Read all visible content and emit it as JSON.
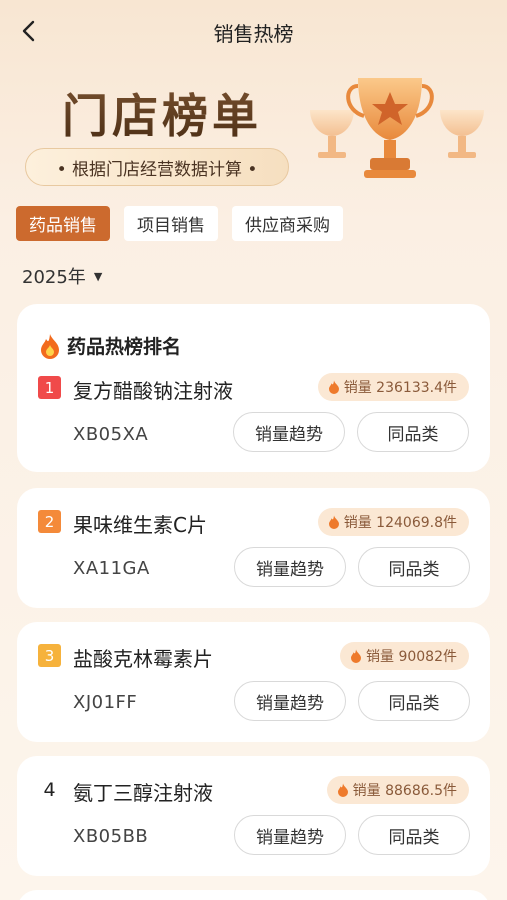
{
  "nav": {
    "title": "销售热榜"
  },
  "hero": {
    "title": "门店榜单",
    "subtitle": "• 根据门店经营数据计算 •"
  },
  "tabs": [
    {
      "label": "药品销售",
      "active": true
    },
    {
      "label": "项目销售",
      "active": false
    },
    {
      "label": "供应商采购",
      "active": false
    }
  ],
  "year": {
    "label": "2025年"
  },
  "list": {
    "header": "药品热榜排名",
    "trend_label": "销量趋势",
    "same_label": "同品类",
    "items": [
      {
        "rank": "1",
        "name": "复方醋酸钠注射液",
        "code": "XB05XA",
        "sales": "销量 236133.4件",
        "rank_color": "#f04a4a"
      },
      {
        "rank": "2",
        "name": "果味维生素C片",
        "code": "XA11GA",
        "sales": "销量 124069.8件",
        "rank_color": "#f48a3a"
      },
      {
        "rank": "3",
        "name": "盐酸克林霉素片",
        "code": "XJ01FF",
        "sales": "销量 90082件",
        "rank_color": "#f6b23c"
      },
      {
        "rank": "4",
        "name": "氨丁三醇注射液",
        "code": "XB05BB",
        "sales": "销量 88686.5件",
        "rank_color": ""
      }
    ]
  },
  "colors": {
    "accent": "#cc6a2e",
    "badge_bg": "#fbe8d4",
    "flame": "#ee7a2c"
  }
}
